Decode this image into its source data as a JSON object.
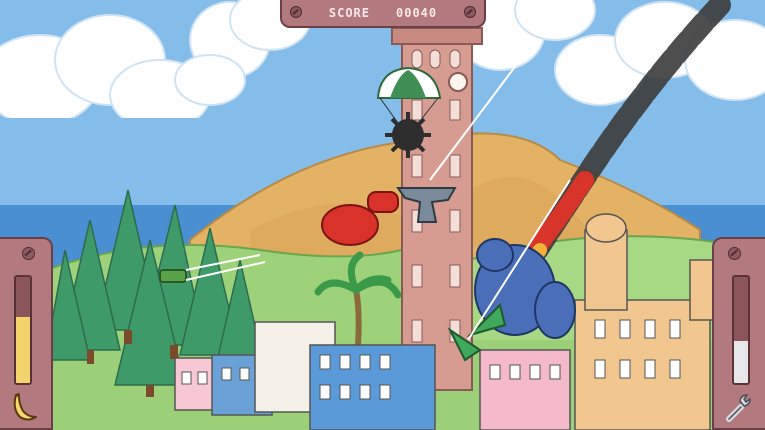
{
  "hud": {
    "score_label": "SCORE",
    "score_value": "00040"
  },
  "gauges": {
    "left_banana_power": 0.62,
    "right_tool_charge": 0.4
  },
  "colors": {
    "panel": "#b27a7e",
    "panel_dark": "#6b3f45",
    "banana_fill": "#f3d36b",
    "tool_fill": "#e7e7ea",
    "sky": "#7fb9e8",
    "grass": "#8fc96a",
    "mountain": "#e4b465",
    "smoke": "#3a3a3a"
  },
  "icons": {
    "left": "banana-icon",
    "right": "wrench-icon"
  }
}
